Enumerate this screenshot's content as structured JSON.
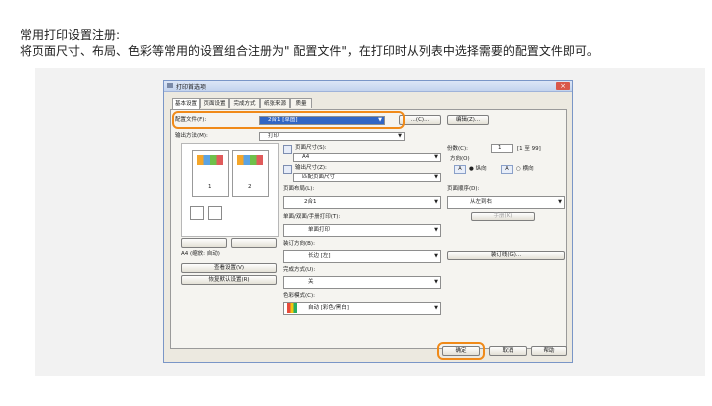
{
  "intro": {
    "line1": "常用打印设置注册:",
    "line2": "将页面尺寸、布局、色彩等常用的设置组合注册为\" 配置文件\"，在打印时从列表中选择需要的配置文件即可。"
  },
  "dialog": {
    "title": "打印首选项",
    "close_label": "×",
    "tabs": [
      "基本设置",
      "页面设置",
      "完成方式",
      "纸张来源",
      "质量"
    ],
    "profile_label": "配置文件(F):",
    "profile_value": "2合1 [草图]",
    "add_button": "...(C)...",
    "edit_button": "编辑(Z)...",
    "output_label": "输出方法(M):",
    "output_value": "打印",
    "page_size_label": "页面尺寸(S):",
    "page_size_value": "A4",
    "output_size_label": "输出尺寸(Z):",
    "output_size_value": "匹配页面尺寸",
    "copies_label": "份数(C):",
    "copies_value": "1",
    "copies_range": "[1 至 99]",
    "orientation_label": "方向(O)",
    "portrait_label": "纵向",
    "landscape_label": "横向",
    "layout_label": "页面布局(L):",
    "layout_value": "2合1",
    "page_order_label": "页面顺序(D):",
    "page_order_value": "从左到右",
    "duplex_label": "单面/双面/手册打印(T):",
    "duplex_value": "单面打印",
    "booklet_button": "手册(K)",
    "binding_label": "装订方向(B):",
    "binding_value": "长边 [左]",
    "gutter_button": "装订线(G)...",
    "finishing_label": "完成方式(U):",
    "finishing_value": "关",
    "color_label": "色彩模式(C):",
    "color_value": "自动 [彩色/黑白]",
    "preview_status": "A4 (缩放: 自动)",
    "page1": "1",
    "page2": "2",
    "view_settings_button": "查看设置(V)",
    "restore_button": "恢复默认设置(R)",
    "ok_button": "确定",
    "cancel_button": "取消",
    "help_button": "帮助"
  }
}
